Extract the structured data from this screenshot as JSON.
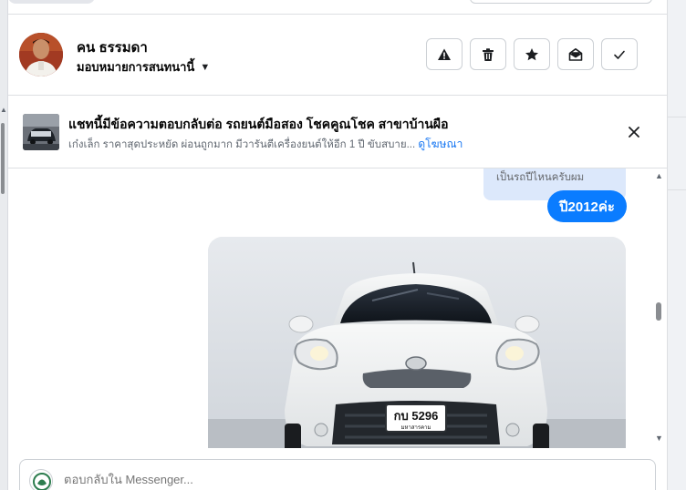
{
  "header": {
    "contact_name": "คน ธรรมดา",
    "assign_label": "มอบหมายการสนทนานี้",
    "actions": [
      {
        "name": "report-spam-button",
        "icon": "warning-triangle-icon"
      },
      {
        "name": "delete-button",
        "icon": "trash-icon"
      },
      {
        "name": "star-button",
        "icon": "star-icon"
      },
      {
        "name": "mark-unread-button",
        "icon": "envelope-open-icon"
      },
      {
        "name": "mark-done-button",
        "icon": "checkmark-icon"
      }
    ]
  },
  "ad_banner": {
    "title": "แชทนี้มีข้อความตอบกลับต่อ รถยนต์มือสอง โชคคูณโชค สาขาบ้านผือ",
    "subtitle": "เก๋งเล็ก ราคาสุดประหยัด ผ่อนถูกมาก มีวารันตีเครื่องยนต์ให้อีก 1 ปี ขับสบาย...",
    "link_label": "ดูโฆษณา",
    "close_icon": "close-icon"
  },
  "conversation": {
    "quoted_message": "เป็นรถปีไหนครับผม",
    "sent_message": "ปี2012ค่ะ",
    "photo": {
      "plate_text": "กบ 5296",
      "plate_province": "มหาสารคาม"
    }
  },
  "composer": {
    "placeholder": "ตอบกลับใน Messenger..."
  },
  "colors": {
    "accent": "#0a7cff",
    "link": "#1877f2",
    "quoted_bg": "#dce8fb",
    "border": "#dddfe2"
  }
}
